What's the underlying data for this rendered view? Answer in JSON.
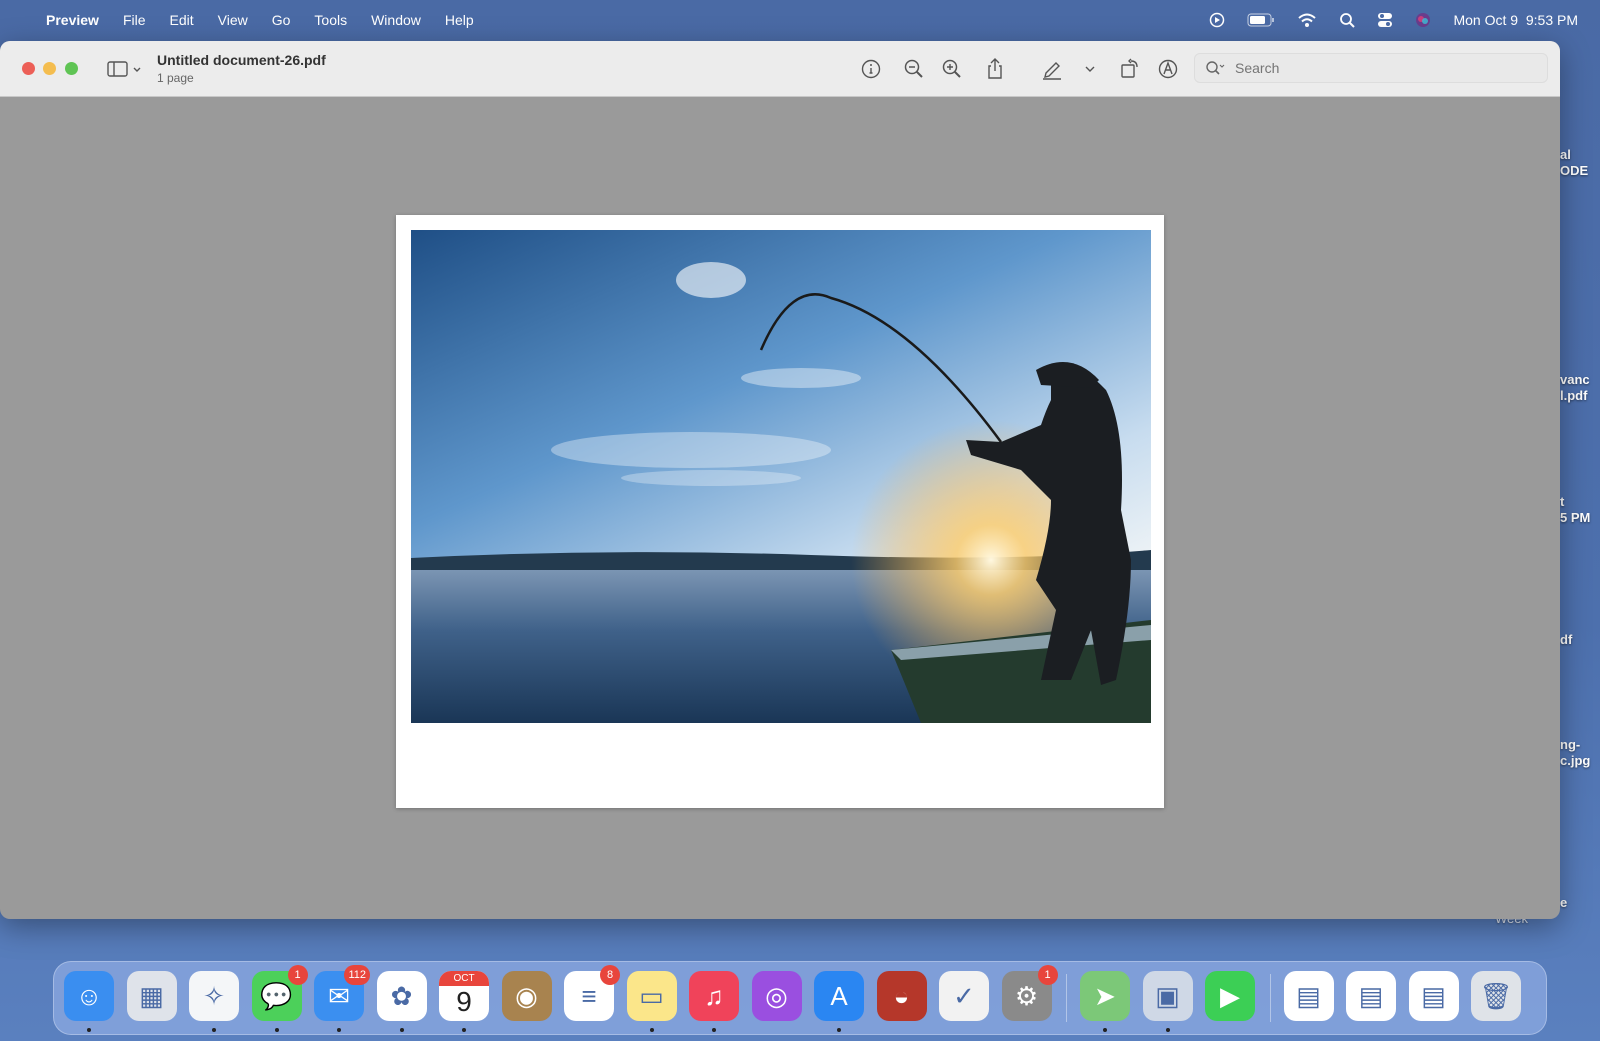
{
  "menubar": {
    "apple_icon": "apple-logo",
    "app": "Preview",
    "items": [
      "File",
      "Edit",
      "View",
      "Go",
      "Tools",
      "Window",
      "Help"
    ],
    "date": "Mon Oct 9",
    "time": "9:53 PM",
    "status_icons": [
      "screen-record-icon",
      "battery-icon",
      "wifi-icon",
      "spotlight-icon",
      "control-center-icon",
      "siri-icon"
    ]
  },
  "window": {
    "title": "Untitled document-26.pdf",
    "subtitle": "1 page",
    "search_placeholder": "Search",
    "toolbar_icons": [
      "sidebar-icon",
      "info-icon",
      "zoom-out-icon",
      "zoom-in-icon",
      "share-icon",
      "markup-pen-icon",
      "chevron-down-icon",
      "rotate-icon",
      "annotate-icon"
    ]
  },
  "desktop_labels": [
    [
      "al",
      "ODE"
    ],
    [
      "vanc",
      "l.pdf"
    ],
    [
      "t",
      "5 PM"
    ],
    [
      "df",
      ""
    ],
    [
      "ng-",
      "c.jpg"
    ],
    [
      "e",
      "Week"
    ]
  ],
  "dock": {
    "items": [
      {
        "name": "Finder",
        "badge": "",
        "color": "#3a8ef0"
      },
      {
        "name": "Launchpad",
        "badge": "",
        "color": "#dfe3ea"
      },
      {
        "name": "Safari",
        "badge": "",
        "color": "#f4f6f8"
      },
      {
        "name": "Messages",
        "badge": "1",
        "color": "#4cd05a"
      },
      {
        "name": "Mail",
        "badge": "112",
        "color": "#3b8ff0"
      },
      {
        "name": "Photos",
        "badge": "",
        "color": "#ffffff"
      },
      {
        "name": "Calendar",
        "badge": "",
        "color": "#ffffff",
        "month": "OCT",
        "day": "9"
      },
      {
        "name": "Contacts",
        "badge": "",
        "color": "#a8834f"
      },
      {
        "name": "Reminders",
        "badge": "8",
        "color": "#ffffff"
      },
      {
        "name": "Notes",
        "badge": "",
        "color": "#fbe68a"
      },
      {
        "name": "Music",
        "badge": "",
        "color": "#f0435a"
      },
      {
        "name": "Podcasts",
        "badge": "",
        "color": "#9a4fe0"
      },
      {
        "name": "App Store",
        "badge": "",
        "color": "#2a86f2"
      },
      {
        "name": "Paprika",
        "badge": "",
        "color": "#b5372a"
      },
      {
        "name": "Script Editor",
        "badge": "",
        "color": "#f2f2f2"
      },
      {
        "name": "System Settings",
        "badge": "1",
        "color": "#8a8a8a"
      },
      {
        "name": "Maps",
        "badge": "",
        "color": "#7cc878"
      },
      {
        "name": "Preview",
        "badge": "",
        "color": "#cfd8e6"
      },
      {
        "name": "FaceTime",
        "badge": "",
        "color": "#3ccf55"
      },
      {
        "name": "Recent Document 1",
        "badge": "",
        "color": "#ffffff"
      },
      {
        "name": "Recent Document 2",
        "badge": "",
        "color": "#ffffff"
      },
      {
        "name": "Recent Document 3",
        "badge": "",
        "color": "#ffffff"
      },
      {
        "name": "Trash",
        "badge": "",
        "color": "#dfe3e8"
      }
    ]
  }
}
